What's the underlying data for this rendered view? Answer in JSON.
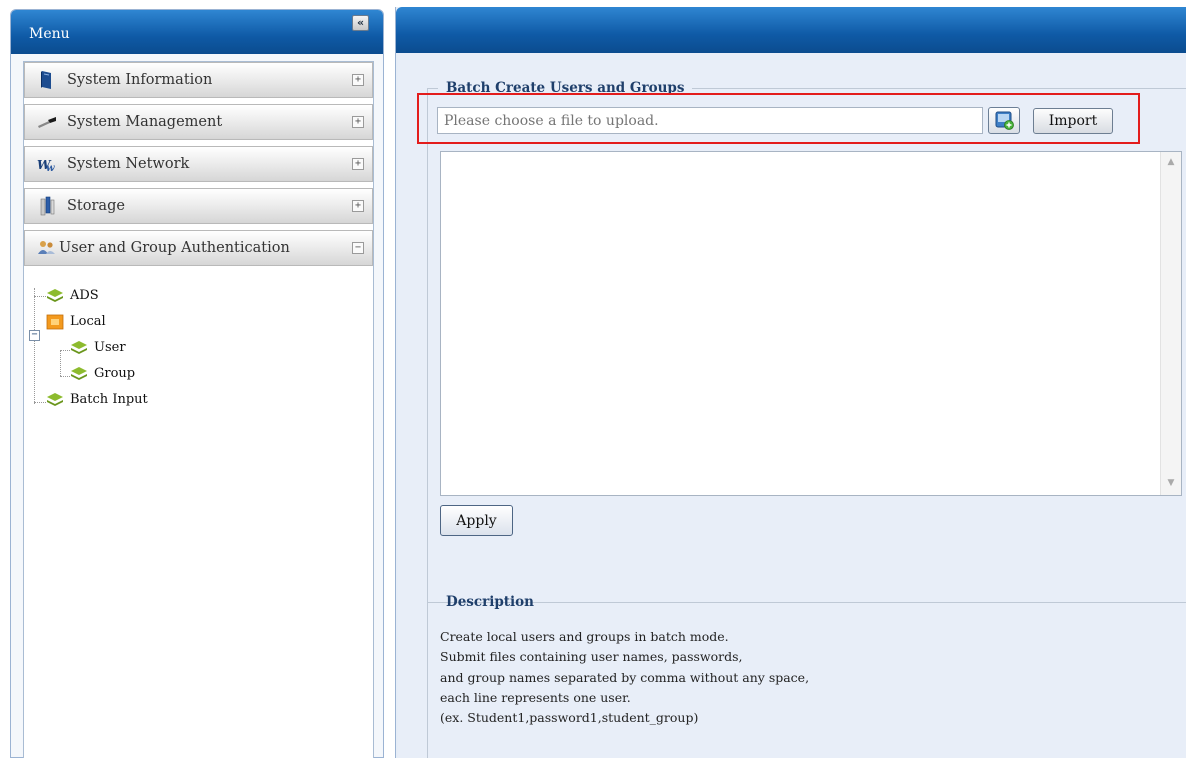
{
  "menu": {
    "title": "Menu",
    "collapse_glyph": "«",
    "sections": [
      {
        "label": "System Information",
        "icon": "book-icon",
        "toggle": "+"
      },
      {
        "label": "System Management",
        "icon": "wrench-icon",
        "toggle": "+"
      },
      {
        "label": "System Network",
        "icon": "network-icon",
        "toggle": "+"
      },
      {
        "label": "Storage",
        "icon": "storage-icon",
        "toggle": "+"
      },
      {
        "label": "User and Group Authentication",
        "icon": "users-icon",
        "toggle": "−"
      }
    ],
    "tree": {
      "ads": "ADS",
      "local": "Local",
      "local_expander": "−",
      "user": "User",
      "group": "Group",
      "batch_input": "Batch Input"
    }
  },
  "batch": {
    "legend": "Batch Create Users and Groups",
    "file_placeholder": "Please choose a file to upload.",
    "import_label": "Import",
    "apply_label": "Apply"
  },
  "description": {
    "legend": "Description",
    "lines": [
      "Create local users and groups in batch mode.",
      "Submit files containing user names, passwords,",
      "and group names separated by comma without any space,",
      "each line represents one user.",
      "(ex. Student1,password1,student_group)"
    ]
  },
  "colors": {
    "header_blue": "#0f5aa6",
    "highlight_red": "#e31c1c",
    "legend_blue": "#1f3f6b"
  }
}
